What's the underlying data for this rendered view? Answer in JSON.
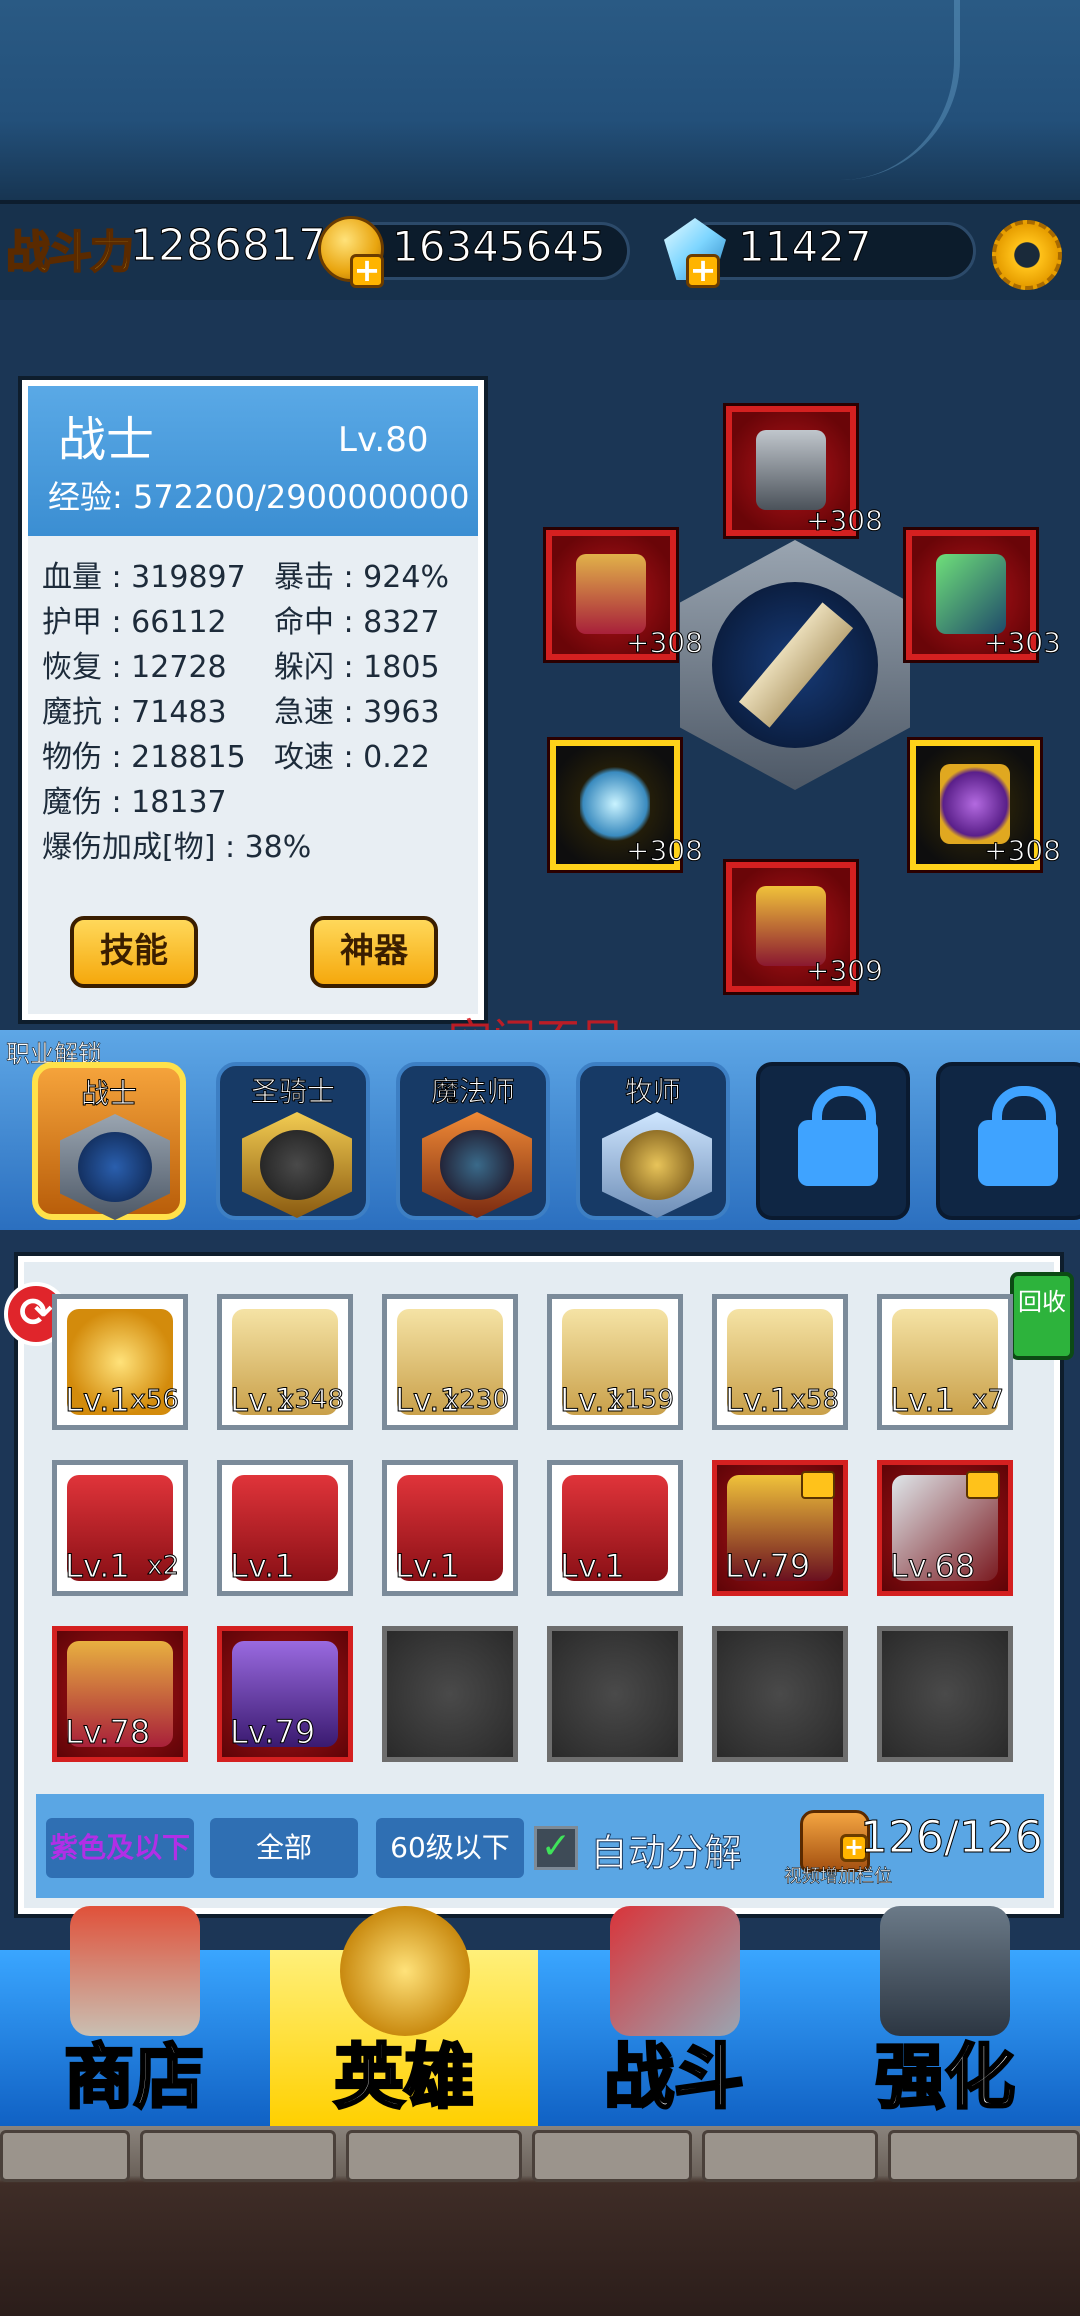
{
  "resources": {
    "power_label": "战斗力",
    "power_value": "12868170",
    "gold_value": "16345645",
    "gem_value": "11427",
    "icons": [
      "coin-icon",
      "gem-icon",
      "plus-icon",
      "gear-icon"
    ]
  },
  "hero": {
    "class_name": "战士",
    "level": "Lv.80",
    "exp": "经验: 572200/2900000000",
    "stats_left": [
      "血量 : 319897",
      "护甲 : 66112",
      "恢复 : 12728",
      "魔抗 : 71483",
      "物伤 : 218815",
      "魔伤 : 18137",
      "爆伤加成[物] : 38%"
    ],
    "stats_right": [
      "暴击 : 924%",
      "命中 : 8327",
      "躲闪 : 1805",
      "急速 : 3963",
      "攻速 : 0.22"
    ],
    "skill_button": "技能",
    "artifact_button": "神器"
  },
  "equipment": [
    {
      "slot": "helmet",
      "plus": "+308",
      "frame": "red"
    },
    {
      "slot": "armor",
      "plus": "+308",
      "frame": "red"
    },
    {
      "slot": "weapon",
      "plus": "+303",
      "frame": "red"
    },
    {
      "slot": "necklace",
      "plus": "+308",
      "frame": "gold"
    },
    {
      "slot": "ring",
      "plus": "+308",
      "frame": "gold"
    },
    {
      "slot": "boots",
      "plus": "+309",
      "frame": "red"
    }
  ],
  "alert_text": "空间不足",
  "class_tabs": {
    "unlock_label": "职业解锁",
    "tabs": [
      {
        "label": "战士",
        "active": true,
        "color": "#1b3f78"
      },
      {
        "label": "圣骑士",
        "active": false,
        "color": "#c99a2a"
      },
      {
        "label": "魔法师",
        "active": false,
        "color": "#c2461f"
      },
      {
        "label": "牧师",
        "active": false,
        "color": "#5b86c9"
      }
    ],
    "locked_count": 2
  },
  "inventory": {
    "recycle_label": "回收",
    "rows": [
      [
        {
          "type": "gold-rune",
          "lv": "Lv.1",
          "qty": "x56"
        },
        {
          "type": "scroll",
          "lv": "Lv.1",
          "qty": "x348"
        },
        {
          "type": "scroll",
          "lv": "Lv.1",
          "qty": "x230"
        },
        {
          "type": "scroll",
          "lv": "Lv.1",
          "qty": "x159"
        },
        {
          "type": "scroll",
          "lv": "Lv.1",
          "qty": "x58"
        },
        {
          "type": "scroll",
          "lv": "Lv.1",
          "qty": "x7"
        }
      ],
      [
        {
          "type": "gem-book",
          "lv": "Lv.1",
          "qty": "x2"
        },
        {
          "type": "gem-book",
          "lv": "Lv.1",
          "qty": ""
        },
        {
          "type": "gem-book",
          "lv": "Lv.1",
          "qty": ""
        },
        {
          "type": "gem-book",
          "lv": "Lv.1",
          "qty": ""
        },
        {
          "type": "boots",
          "lv": "Lv.79",
          "qty": "",
          "locked": true
        },
        {
          "type": "weapon",
          "lv": "Lv.68",
          "qty": "",
          "locked": true
        }
      ],
      [
        {
          "type": "armor",
          "lv": "Lv.78",
          "qty": ""
        },
        {
          "type": "boots-purple",
          "lv": "Lv.79",
          "qty": ""
        },
        {
          "type": "empty",
          "lv": "",
          "qty": ""
        },
        {
          "type": "empty",
          "lv": "",
          "qty": ""
        },
        {
          "type": "empty",
          "lv": "",
          "qty": ""
        },
        {
          "type": "empty",
          "lv": "",
          "qty": ""
        }
      ]
    ],
    "filters": [
      "紫色及以下",
      "全部",
      "60级以下"
    ],
    "auto_label": "自动分解",
    "auto_checked": true,
    "capacity": "126/126",
    "video_hint": "视频增加栏位"
  },
  "nav": [
    {
      "label": "商店",
      "active": false
    },
    {
      "label": "英雄",
      "active": true
    },
    {
      "label": "战斗",
      "active": false
    },
    {
      "label": "强化",
      "active": false
    }
  ]
}
